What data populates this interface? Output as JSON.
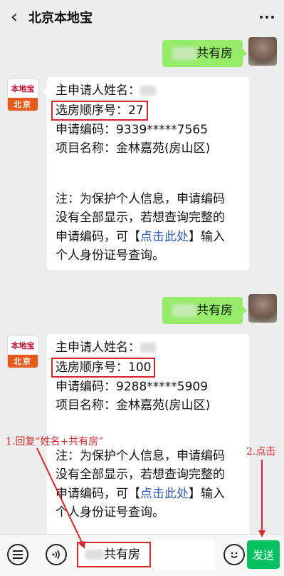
{
  "header": {
    "back_icon": "chevron-left-icon",
    "title": "北京本地宝",
    "more_icon": "more-icon"
  },
  "bot": {
    "logo_text": "本地宝",
    "city": "北京"
  },
  "messages": [
    {
      "type": "sent",
      "text": "共有房"
    },
    {
      "type": "received",
      "lines": [
        "主申请人姓名：",
        "选房顺序号：27",
        "申请编码：9339*****7565",
        "项目名称：金林嘉苑(房山区)"
      ],
      "note": [
        "注：为保护个人信息，申请编码",
        "没有全部显示，若想查询完整的",
        "申请编码，可【",
        "点击此处",
        "】输入",
        "个人身份证号查询。"
      ]
    },
    {
      "type": "sent",
      "text": "共有房"
    },
    {
      "type": "received",
      "lines": [
        "主申请人姓名：",
        "选房顺序号：100",
        "申请编码：9288*****5909",
        "项目名称：金林嘉苑(房山区)"
      ],
      "note": [
        "注：为保护个人信息，申请编码",
        "没有全部显示，若想查询完整的",
        "申请编码，可【",
        "点击此处",
        "】输入",
        "个人身份证号查询。"
      ]
    }
  ],
  "annotations": {
    "step1": "1.回复“姓名+共有房”",
    "step2": "2.点击"
  },
  "inputbar": {
    "menu_icon": "menu-icon",
    "voice_icon": "voice-icon",
    "input_value": "共有房",
    "emoji_icon": "emoji-icon",
    "send_label": "发送"
  },
  "colors": {
    "highlight": "#d7262b",
    "sent_bubble": "#95ec69",
    "send_button": "#07c160",
    "link": "#2c58b8"
  }
}
